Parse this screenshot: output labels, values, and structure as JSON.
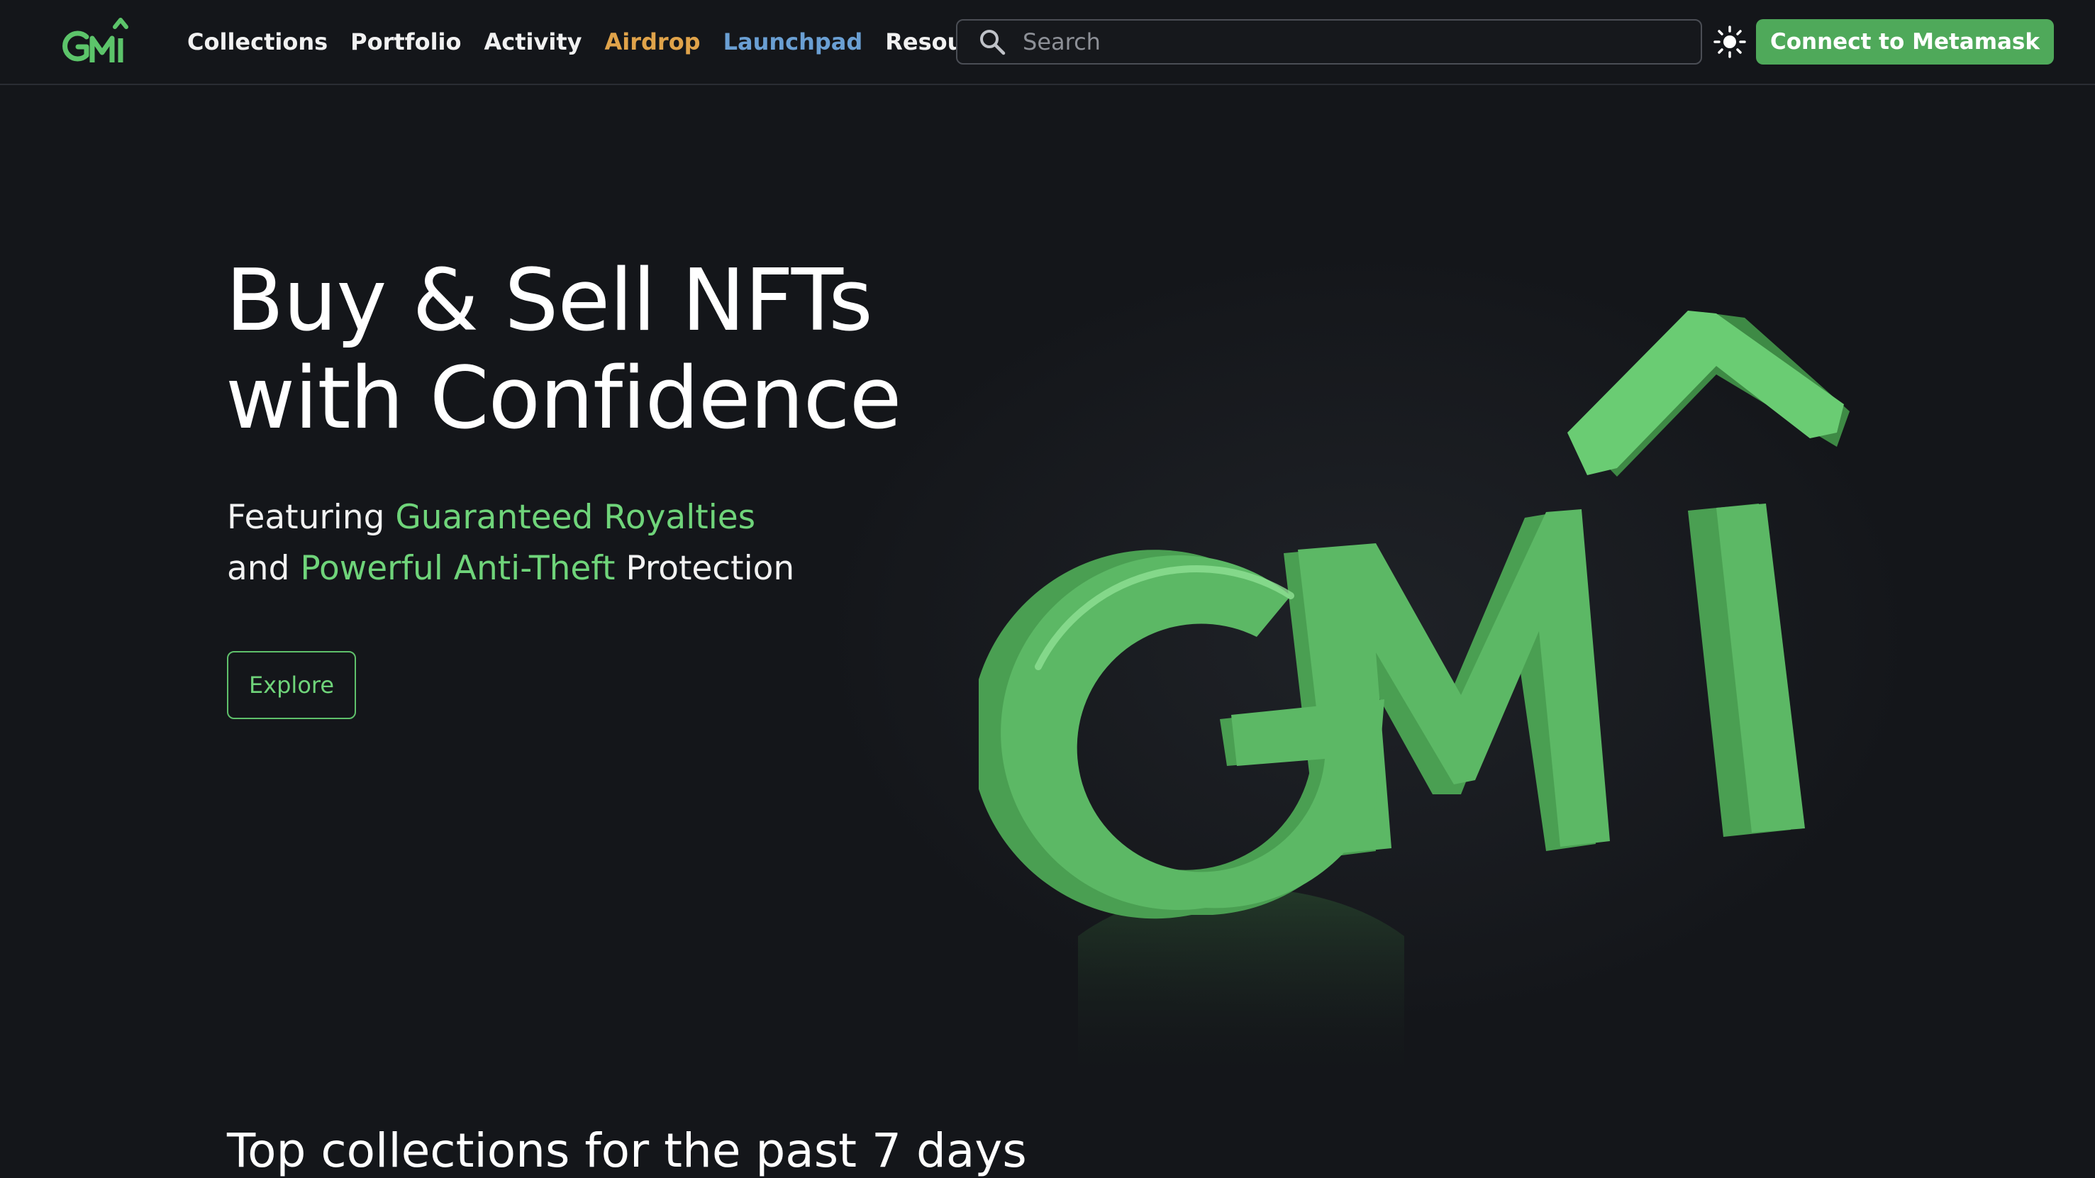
{
  "header": {
    "logo_alt": "GMÎ",
    "nav": [
      {
        "label": "Collections"
      },
      {
        "label": "Portfolio"
      },
      {
        "label": "Activity"
      },
      {
        "label": "Airdrop"
      },
      {
        "label": "Launchpad"
      },
      {
        "label": "Resources"
      }
    ],
    "search": {
      "placeholder": "Search",
      "icon": "search-icon"
    },
    "theme_icon": "sun-icon",
    "connect_label": "Connect to Metamask"
  },
  "hero": {
    "title_line1": "Buy & Sell NFTs",
    "title_line2": "with Confidence",
    "sub_line1_prefix": "Featuring ",
    "sub_line1_highlight": "Guaranteed Royalties",
    "sub_line2_prefix": "and ",
    "sub_line2_highlight": "Powerful Anti-Theft",
    "sub_line2_suffix": " Protection",
    "explore_label": "Explore",
    "art_text": "GMÎ"
  },
  "section": {
    "title": "Top collections for the past 7 days"
  },
  "colors": {
    "background": "#14161a",
    "brand_green": "#4fa95a",
    "highlight_green": "#6fd47a",
    "airdrop": "#e0a34a",
    "launchpad": "#6a9fd3"
  }
}
